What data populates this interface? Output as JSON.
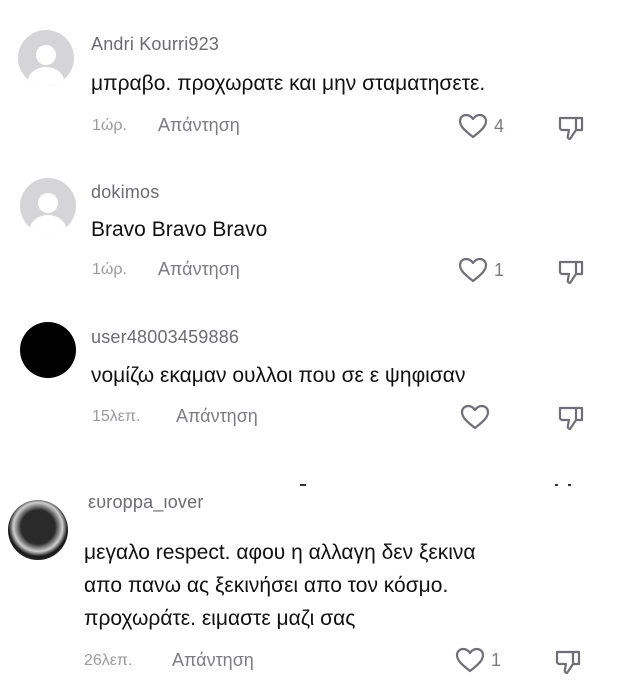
{
  "comments": [
    {
      "username": "Andri Kourri923",
      "text": "μπραβο. προχωρατε και μην σταματησετε.",
      "time": "1ώρ.",
      "reply_label": "Απάντηση",
      "likes": "4",
      "avatar": "default-avatar"
    },
    {
      "username": "dokimos",
      "text": "Bravo Bravo Bravo",
      "time": "1ώρ.",
      "reply_label": "Απάντηση",
      "likes": "1",
      "avatar": "default-avatar"
    },
    {
      "username": "user48003459886",
      "text": "νομίζω εκαμαν ουλλοι που σε ε ψηφισαν",
      "time": "15λεπ.",
      "reply_label": "Απάντηση",
      "likes": "",
      "avatar": "black-avatar"
    },
    {
      "username": "ευroppa_lover",
      "text_lines": [
        "μεγαλο respect. αφου η αλλαγη δεν ξεκινα",
        "απο πανω ας ξεκινήσει απο τον κόσμο.",
        "προχωράτε. ειμαστε μαζι σας"
      ],
      "time": "26λεπ.",
      "reply_label": "Απάντηση",
      "likes": "1",
      "avatar": "photo-avatar"
    }
  ],
  "icons": {
    "like": "heart-outline-icon",
    "dislike": "thumbs-down-icon"
  },
  "colors": {
    "username": "#6b6b73",
    "text": "#111111",
    "meta": "#9a9aa0"
  }
}
